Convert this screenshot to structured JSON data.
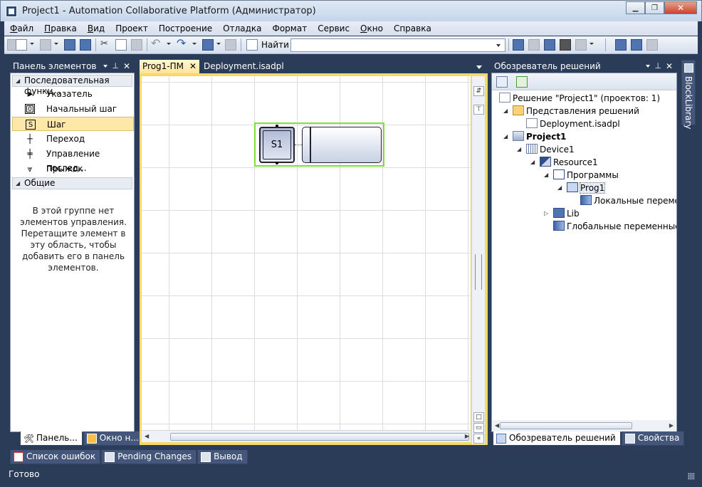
{
  "window": {
    "title": "Project1 - Automation Collaborative Platform (Администратор)"
  },
  "menu": [
    {
      "underline": "Ф",
      "rest": "айл"
    },
    {
      "underline": "П",
      "rest": "равка"
    },
    {
      "underline": "В",
      "rest": "ид"
    },
    {
      "underline": "",
      "rest": "Проект"
    },
    {
      "underline": "",
      "rest": "Построение"
    },
    {
      "underline": "",
      "rest": "Отладка"
    },
    {
      "underline": "",
      "rest": "Формат"
    },
    {
      "underline": "",
      "rest": "Сервис"
    },
    {
      "underline": "О",
      "rest": "кно"
    },
    {
      "underline": "",
      "rest": "Справка"
    }
  ],
  "toolbar": {
    "find_label": "Найти",
    "find_value": ""
  },
  "toolbox": {
    "title": "Панель элементов",
    "group_sequential": "Последовательная функц...",
    "items": [
      {
        "label": "Указатель",
        "icon": "pointer-icon"
      },
      {
        "label": "Начальный шаг",
        "icon": "initial-step-icon"
      },
      {
        "label": "Шаг",
        "icon": "step-icon"
      },
      {
        "label": "Переход",
        "icon": "transition-icon"
      },
      {
        "label": "Управление послед...",
        "icon": "sequence-control-icon"
      },
      {
        "label": "Прыжок",
        "icon": "jump-icon"
      }
    ],
    "group_general": "Общие",
    "empty_text": "В этой группе нет элементов управления. Перетащите элемент в эту область, чтобы добавить его в панель элементов.",
    "bottom_tabs": [
      "Панель...",
      "Окно н..."
    ]
  },
  "editor": {
    "tabs": [
      "Prog1-ПМ",
      "Deployment.isadpl"
    ],
    "step_label": "S1"
  },
  "solution_explorer": {
    "title": "Обозреватель решений",
    "tree": [
      {
        "label": "Решение \"Project1\"  (проектов: 1)",
        "level": 0,
        "exp": "",
        "bold": false
      },
      {
        "label": "Представления решений",
        "level": 1,
        "exp": "◢",
        "bold": false
      },
      {
        "label": "Deployment.isadpl",
        "level": 2,
        "exp": "",
        "bold": false
      },
      {
        "label": "Project1",
        "level": 1,
        "exp": "◢",
        "bold": true
      },
      {
        "label": "Device1",
        "level": 2,
        "exp": "◢",
        "bold": false
      },
      {
        "label": "Resource1",
        "level": 3,
        "exp": "◢",
        "bold": false
      },
      {
        "label": "Программы",
        "level": 4,
        "exp": "◢",
        "bold": false
      },
      {
        "label": "Prog1",
        "level": 5,
        "exp": "◢",
        "bold": false
      },
      {
        "label": "Локальные перемен",
        "level": 6,
        "exp": "",
        "bold": false
      },
      {
        "label": "Lib",
        "level": 4,
        "exp": "▷",
        "bold": false
      },
      {
        "label": "Глобальные переменные",
        "level": 4,
        "exp": "",
        "bold": false
      }
    ],
    "bottom_tabs": [
      "Обозреватель решений",
      "Свойства"
    ]
  },
  "side_tab": "BlockLibrary",
  "output_tabs": [
    "Список ошибок",
    "Pending Changes",
    "Вывод"
  ],
  "status": "Готово"
}
